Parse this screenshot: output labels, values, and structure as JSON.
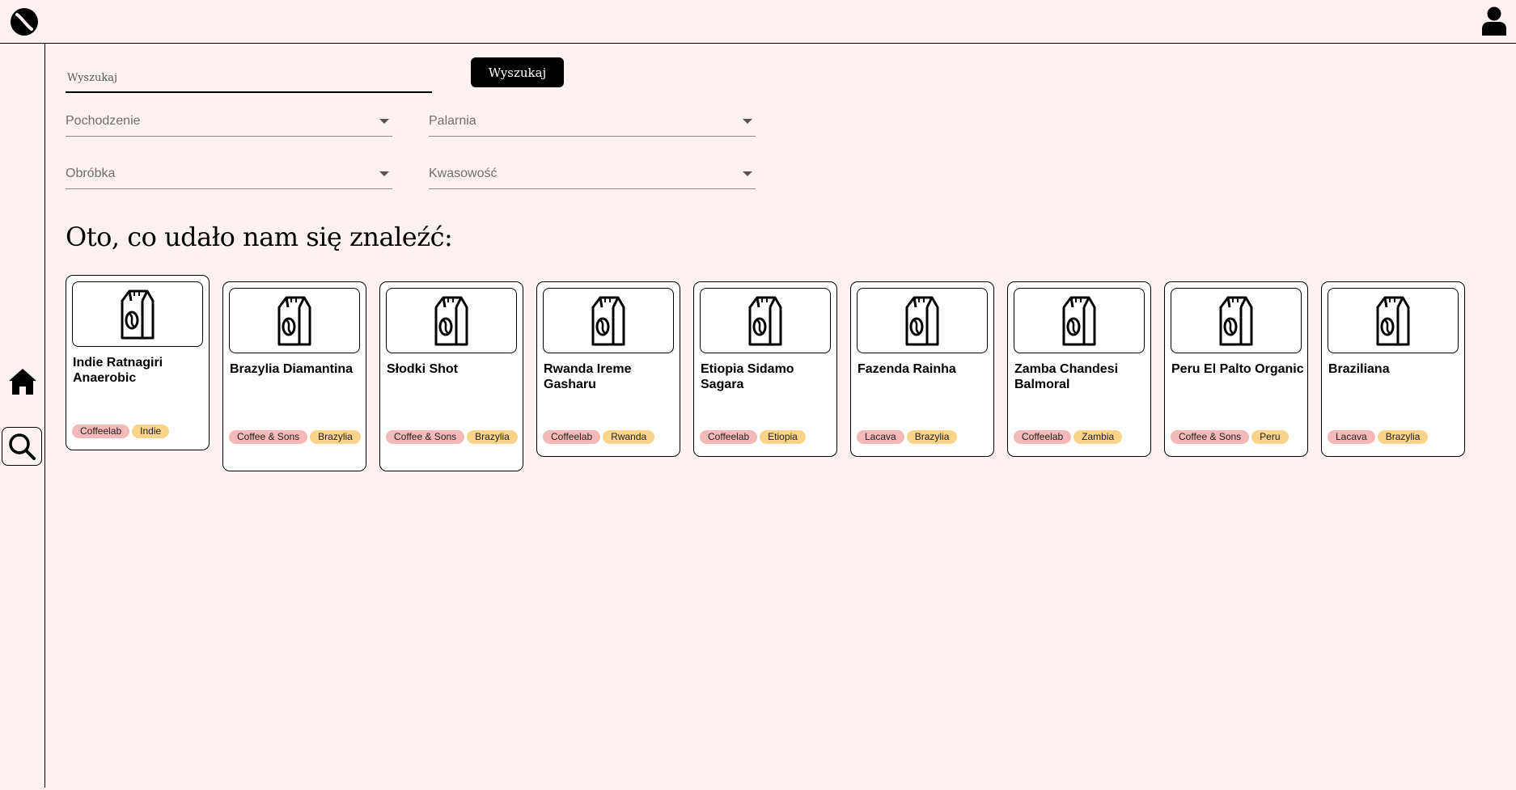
{
  "header": {
    "logo_icon": "coffee-bean-logo-icon",
    "user_icon": "user-icon"
  },
  "sidebar": {
    "items": [
      {
        "icon": "home-icon"
      },
      {
        "icon": "search-icon"
      }
    ]
  },
  "search": {
    "placeholder": "Wyszukaj",
    "value": "",
    "button_label": "Wyszukaj"
  },
  "filters": {
    "origin_label": "Pochodzenie",
    "roastery_label": "Palarnia",
    "processing_label": "Obróbka",
    "acidity_label": "Kwasowość"
  },
  "results": {
    "heading": "Oto, co udało nam się znaleźć:",
    "cards": [
      {
        "name": "Indie Ratnagiri Anaerobic",
        "roaster": "Coffeelab",
        "origin": "Indie",
        "image_icon": "coffee-bag-icon"
      },
      {
        "name": "Brazylia Diamantina",
        "roaster": "Coffee & Sons",
        "origin": "Brazylia",
        "image_icon": "coffee-bag-icon"
      },
      {
        "name": "Słodki Shot",
        "roaster": "Coffee & Sons",
        "origin": "Brazylia",
        "image_icon": "coffee-bag-icon"
      },
      {
        "name": "Rwanda Ireme Gasharu",
        "roaster": "Coffeelab",
        "origin": "Rwanda",
        "image_icon": "coffee-bag-icon"
      },
      {
        "name": "Etiopia Sidamo Sagara",
        "roaster": "Coffeelab",
        "origin": "Etiopia",
        "image_icon": "coffee-bag-icon"
      },
      {
        "name": "Fazenda Rainha",
        "roaster": "Lacava",
        "origin": "Brazylia",
        "image_icon": "coffee-bag-icon"
      },
      {
        "name": "Zamba Chandesi Balmoral",
        "roaster": "Coffeelab",
        "origin": "Zambia",
        "image_icon": "coffee-bag-icon"
      },
      {
        "name": "Peru El Palto Organic",
        "roaster": "Coffee & Sons",
        "origin": "Peru",
        "image_icon": "coffee-bag-icon"
      },
      {
        "name": "Braziliana",
        "roaster": "Lacava",
        "origin": "Brazylia",
        "image_icon": "coffee-bag-icon"
      }
    ]
  },
  "colors": {
    "background": "#fdf2f1",
    "roaster_tag": "#f4b9b9",
    "origin_tag": "#f9d48a",
    "button": "#000000"
  }
}
